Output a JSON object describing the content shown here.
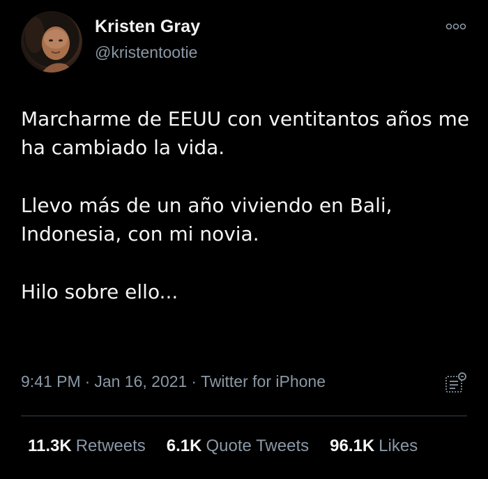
{
  "author": {
    "display_name": "Kristen Gray",
    "handle": "@kristentootie"
  },
  "tweet": {
    "paragraphs": [
      "Marcharme de EEUU con ventitantos años me ha cambiado la vida.",
      "Llevo más de un año viviendo en Bali, Indonesia, con mi novia.",
      "Hilo sobre ello..."
    ],
    "time": "9:41 PM",
    "separator": "·",
    "date": "Jan 16, 2021",
    "source": "Twitter for iPhone"
  },
  "stats": {
    "retweets_count": "11.3K",
    "retweets_label": "Retweets",
    "quotes_count": "6.1K",
    "quotes_label": "Quote Tweets",
    "likes_count": "96.1K",
    "likes_label": "Likes"
  },
  "icons": {
    "more": "more-options-icon",
    "analytics": "tweet-analytics-icon"
  },
  "colors": {
    "background": "#000000",
    "primary_text": "#f5f5f5",
    "secondary_text": "#8b98a5",
    "divider": "#38444d"
  }
}
